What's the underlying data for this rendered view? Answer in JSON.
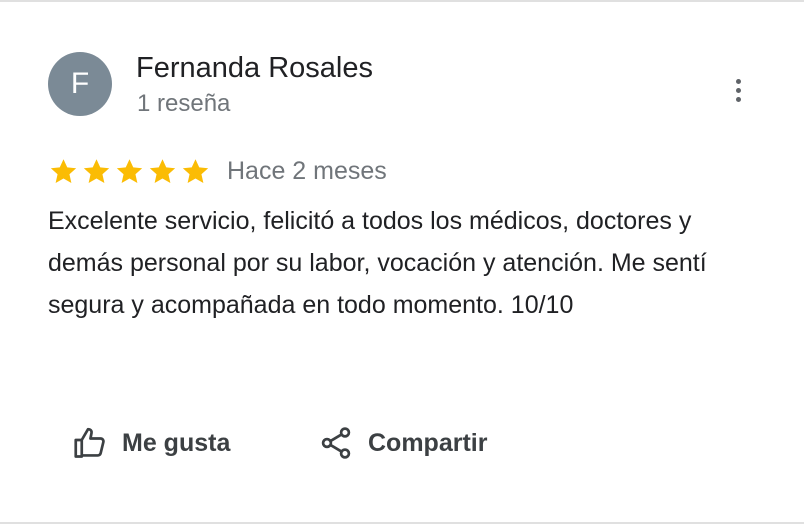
{
  "reviewer": {
    "initial": "F",
    "name": "Fernanda Rosales",
    "review_count": "1 reseña",
    "avatar_color": "#7b8a96"
  },
  "more_options_icon": "more-vert-icon",
  "rating": {
    "stars": 5,
    "max_stars": 5,
    "star_color": "#fbbc04",
    "icon": "star-icon"
  },
  "time_ago": "Hace 2 meses",
  "review_text": "Excelente servicio, felicitó a todos los médicos, doctores y demás personal por su labor, vocación y atención. Me sentí segura y acompañada en todo momento. 10/10",
  "actions": {
    "like": {
      "label": "Me gusta",
      "icon": "thumb-up-icon"
    },
    "share": {
      "label": "Compartir",
      "icon": "share-icon"
    }
  }
}
